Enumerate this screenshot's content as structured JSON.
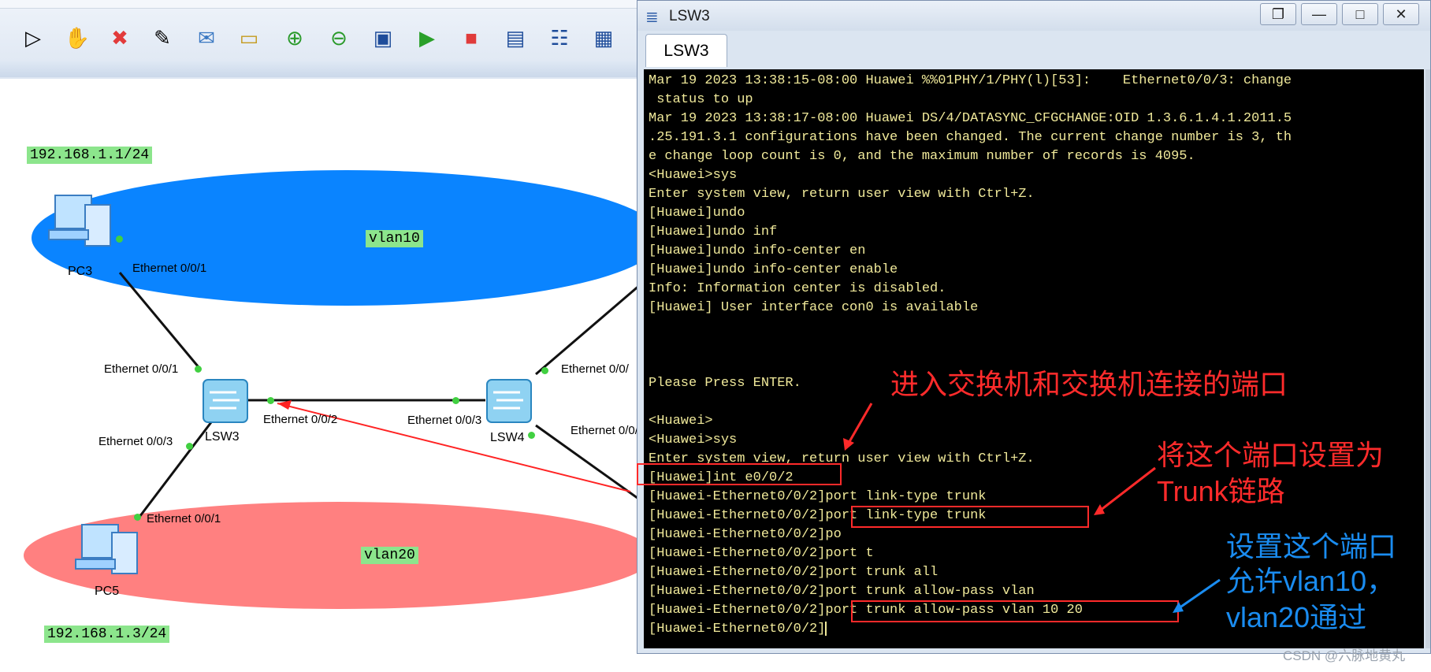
{
  "topology": {
    "ip_labels": [
      "192.168.1.1/24",
      "192.168.1.3/24"
    ],
    "vlan_labels": [
      "vlan10",
      "vlan20"
    ],
    "devices": {
      "pc3": "PC3",
      "pc5": "PC5",
      "lsw3": "LSW3",
      "lsw4": "LSW4"
    },
    "ports": {
      "pc3_e001": "Ethernet 0/0/1",
      "lsw3_e001": "Ethernet 0/0/1",
      "lsw3_e002": "Ethernet 0/0/2",
      "lsw3_e003": "Ethernet 0/0/3",
      "lsw4_e003": "Ethernet 0/0/3",
      "lsw4_e00_top": "Ethernet 0/0/",
      "lsw4_e00_bottom": "Ethernet 0/0/",
      "pc5_e001": "Ethernet 0/0/1"
    },
    "colors": {
      "vlan10": "#0a84ff",
      "vlan20": "#ff8080",
      "label_bg": "#8ce58c"
    }
  },
  "toolbar": {
    "icons": [
      "arrow-icon",
      "hand-icon",
      "delete-icon",
      "eraser-icon",
      "text-note-icon",
      "rectangle-icon",
      "zoom-in-icon",
      "zoom-out-icon",
      "fit-icon",
      "start-icon",
      "stop-icon",
      "capture-icon",
      "topology-icon",
      "grid-icon"
    ]
  },
  "terminal": {
    "title": "LSW3",
    "tab": "LSW3",
    "lines": [
      "Mar 19 2023 13:38:15-08:00 Huawei %%01PHY/1/PHY(l)[53]:    Ethernet0/0/3: change",
      " status to up",
      "Mar 19 2023 13:38:17-08:00 Huawei DS/4/DATASYNC_CFGCHANGE:OID 1.3.6.1.4.1.2011.5",
      ".25.191.3.1 configurations have been changed. The current change number is 3, th",
      "e change loop count is 0, and the maximum number of records is 4095.",
      "<Huawei>sys",
      "Enter system view, return user view with Ctrl+Z.",
      "[Huawei]undo",
      "[Huawei]undo inf",
      "[Huawei]undo info-center en",
      "[Huawei]undo info-center enable",
      "Info: Information center is disabled.",
      "[Huawei] User interface con0 is available",
      "",
      "",
      "",
      "Please Press ENTER.",
      "",
      "<Huawei>",
      "<Huawei>sys",
      "Enter system view, return user view with Ctrl+Z.",
      "[Huawei]int e0/0/2",
      "[Huawei-Ethernet0/0/2]port link-type trunk",
      "[Huawei-Ethernet0/0/2]port link-type trunk",
      "[Huawei-Ethernet0/0/2]po",
      "[Huawei-Ethernet0/0/2]port t",
      "[Huawei-Ethernet0/0/2]port trunk all",
      "[Huawei-Ethernet0/0/2]port trunk allow-pass vlan",
      "[Huawei-Ethernet0/0/2]port trunk allow-pass vlan 10 20",
      "[Huawei-Ethernet0/0/2]"
    ]
  },
  "annotations": {
    "enter_port": "进入交换机和交换机连接的端口",
    "trunk_line1": "将这个端口设置为",
    "trunk_line2": "Trunk链路",
    "allow_line1": "设置这个端口",
    "allow_line2": "允许vlan10，",
    "allow_line3": "vlan20通过"
  },
  "watermark": "CSDN @六脉地黄丸"
}
